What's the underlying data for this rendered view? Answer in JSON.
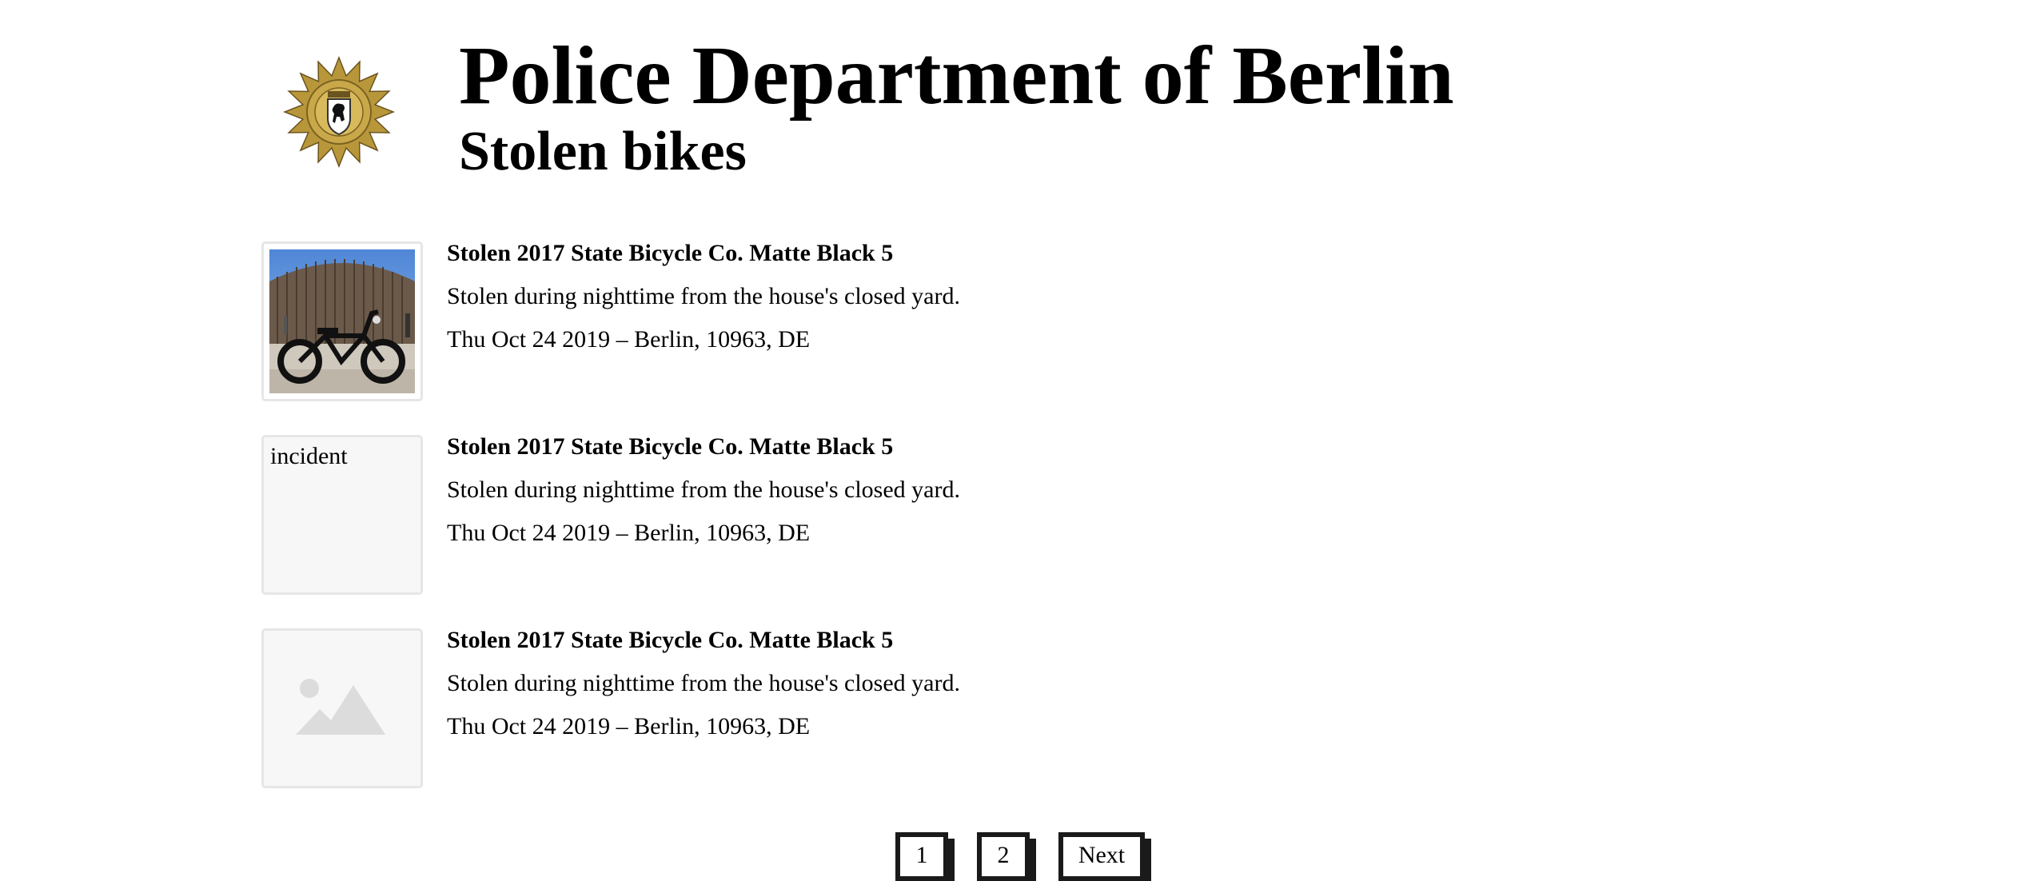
{
  "header": {
    "logo_icon": "berlin-police-star-icon",
    "title": "Police Department of Berlin",
    "subtitle": "Stolen bikes"
  },
  "incidents": [
    {
      "thumbnail": "photo",
      "thumbnail_alt": "",
      "title": "Stolen 2017 State Bicycle Co. Matte Black 5",
      "description": "Stolen during nighttime from the house's closed yard.",
      "meta": "Thu Oct 24 2019 – Berlin, 10963, DE"
    },
    {
      "thumbnail": "alt-text",
      "thumbnail_alt": "incident",
      "title": "Stolen 2017 State Bicycle Co. Matte Black 5",
      "description": "Stolen during nighttime from the house's closed yard.",
      "meta": "Thu Oct 24 2019 – Berlin, 10963, DE"
    },
    {
      "thumbnail": "placeholder",
      "thumbnail_alt": "",
      "title": "Stolen 2017 State Bicycle Co. Matte Black 5",
      "description": "Stolen during nighttime from the house's closed yard.",
      "meta": "Thu Oct 24 2019 – Berlin, 10963, DE"
    }
  ],
  "pagination": {
    "pages": [
      "1",
      "2"
    ],
    "next_label": "Next"
  },
  "colors": {
    "text": "#000000",
    "thumb_border": "#e6e6e6",
    "thumb_bg": "#f7f7f7",
    "button_border": "#1a1a1a",
    "placeholder_icon": "#dcdcdc",
    "logo_gold": "#b8973a"
  }
}
